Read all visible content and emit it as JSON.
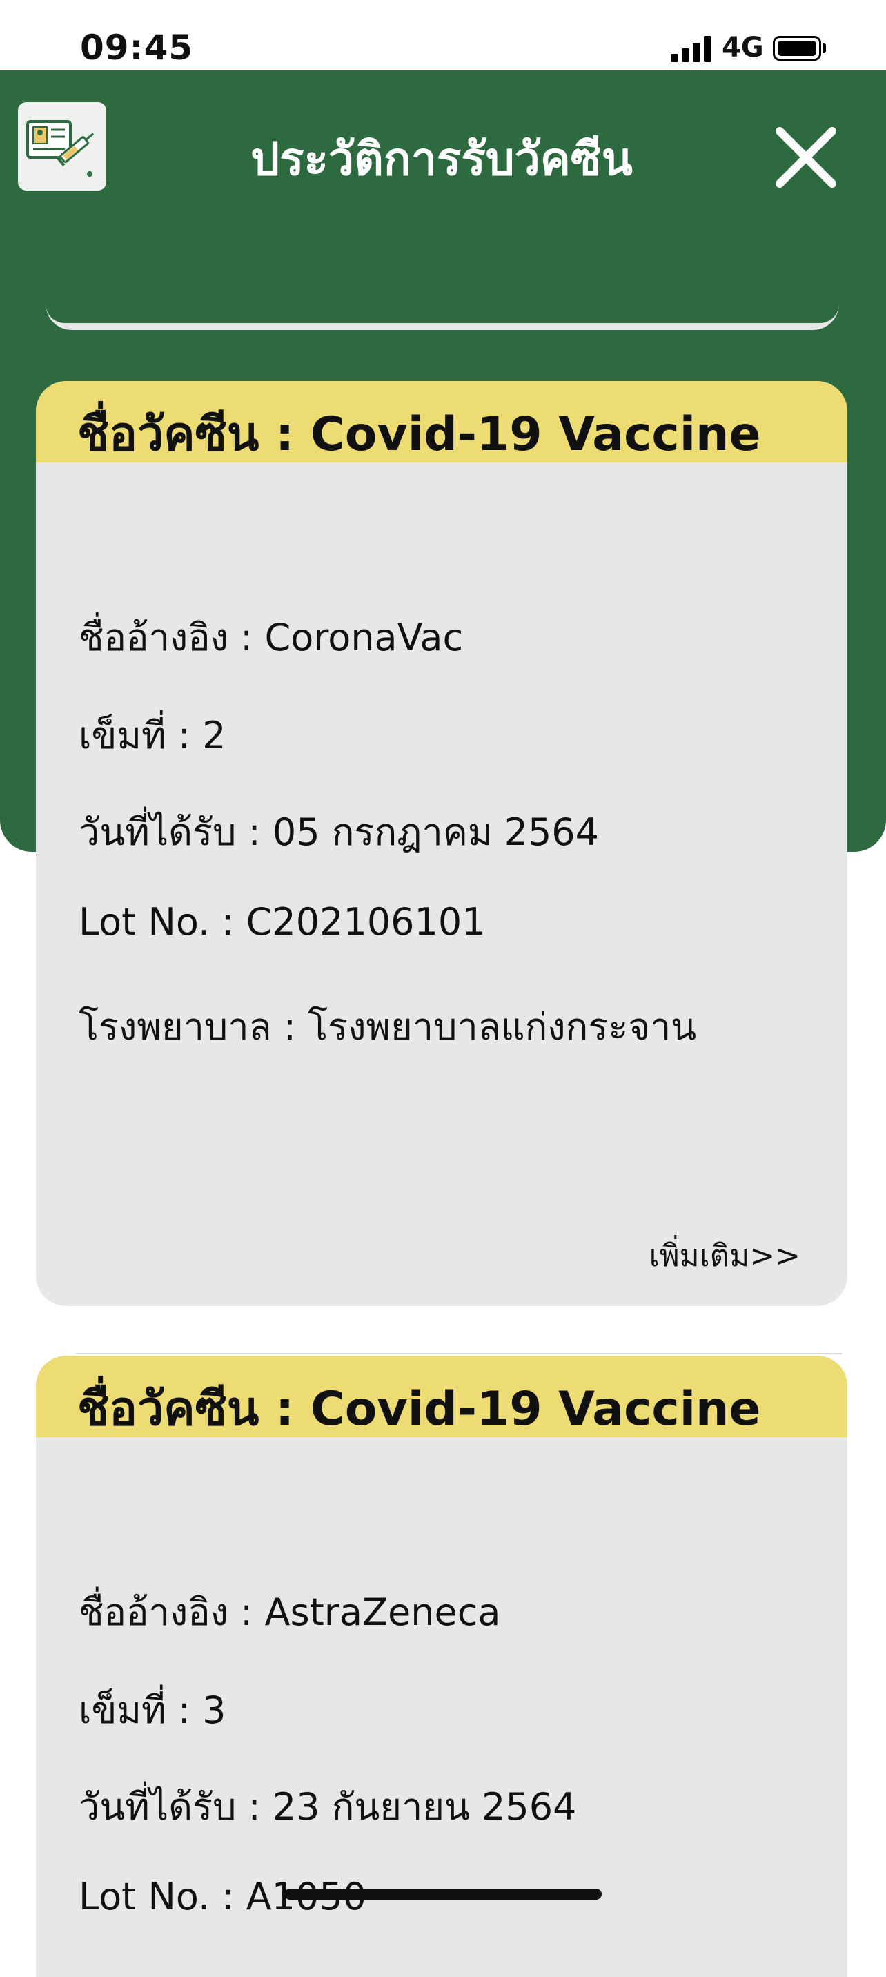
{
  "status_bar": {
    "time": "09:45",
    "network": "4G"
  },
  "header": {
    "title": "ประวัติการรับวัคซีน"
  },
  "cards": [
    {
      "title": "ชื่อวัคซีน : Covid-19 Vaccine",
      "reference_name": "ชื่ออ้างอิง : CoronaVac",
      "dose": "เข็มที่ : 2",
      "date": "วันที่ได้รับ : 05 กรกฎาคม 2564",
      "lot": "Lot No. : C202106101",
      "hospital": "โรงพยาบาล : โรงพยาบาลแก่งกระจาน",
      "more_label": "เพิ่มเติม>>"
    },
    {
      "title": "ชื่อวัคซีน : Covid-19 Vaccine",
      "reference_name": "ชื่ออ้างอิง : AstraZeneca",
      "dose": "เข็มที่ : 3",
      "date": "วันที่ได้รับ : 23 กันยายน 2564",
      "lot": "Lot No. : A1050"
    }
  ],
  "colors": {
    "header_green": "#2d6a40",
    "card_header_yellow": "#eddb73",
    "card_body_gray": "#e7e7e7"
  },
  "icons": {
    "app": "vaccine-certificate-icon",
    "close": "close-icon"
  }
}
